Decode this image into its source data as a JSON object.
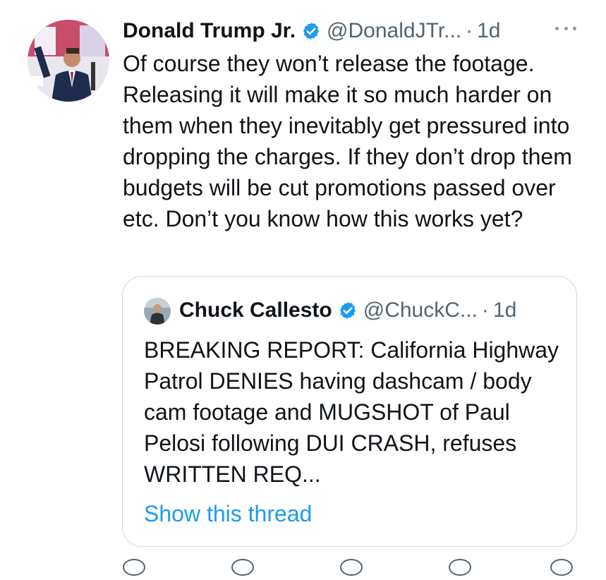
{
  "tweet": {
    "author_name": "Donald Trump Jr.",
    "handle": "@DonaldJTr...",
    "separator": "·",
    "time": "1d",
    "verified_icon": "verified-badge-icon",
    "text": "Of course they won’t release the footage. Releasing it will make it so much harder on them when they inevitably get pressured into dropping the charges. If they don’t drop them budgets will be cut promotions passed over etc. Don’t you know how this works yet?"
  },
  "quoted_tweet": {
    "author_name": "Chuck Callesto",
    "handle": "@ChuckC...",
    "separator": "·",
    "time": "1d",
    "verified_icon": "verified-badge-icon",
    "text": "BREAKING REPORT: California Highway Patrol DENIES having dashcam / body cam footage and MUGSHOT of Paul Pelosi following DUI CRASH, refuses WRITTEN REQ...",
    "show_thread_label": "Show this thread"
  },
  "colors": {
    "text": "#0f1419",
    "muted": "#536471",
    "accent": "#1d9bf0",
    "border": "#cfd9de"
  }
}
